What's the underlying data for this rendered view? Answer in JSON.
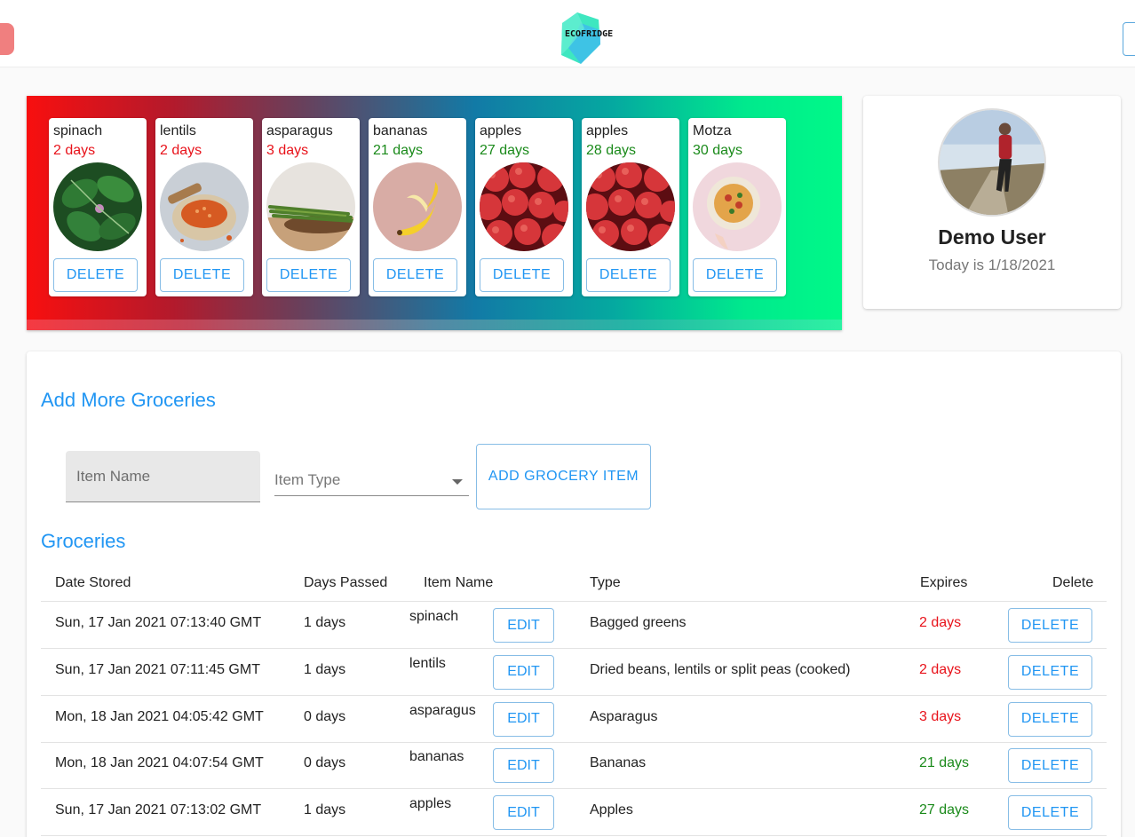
{
  "header": {
    "logo_text": "ECOFRIDGE"
  },
  "colors": {
    "accent": "#2196f3",
    "expiring_soon": "#e8121a",
    "fresh": "#1a8a1a"
  },
  "banner": {
    "cards": [
      {
        "name": "spinach",
        "days": "2 days",
        "status": "expiring",
        "image": "spinach-photo",
        "delete_label": "DELETE"
      },
      {
        "name": "lentils",
        "days": "2 days",
        "status": "expiring",
        "image": "lentils-photo",
        "delete_label": "DELETE"
      },
      {
        "name": "asparagus",
        "days": "3 days",
        "status": "expiring",
        "image": "asparagus-photo",
        "delete_label": "DELETE"
      },
      {
        "name": "bananas",
        "days": "21 days",
        "status": "fresh",
        "image": "banana-photo",
        "delete_label": "DELETE"
      },
      {
        "name": "apples",
        "days": "27 days",
        "status": "fresh",
        "image": "apples-photo",
        "delete_label": "DELETE"
      },
      {
        "name": "apples",
        "days": "28 days",
        "status": "fresh",
        "image": "apples-photo",
        "delete_label": "DELETE"
      },
      {
        "name": "Motza",
        "days": "30 days",
        "status": "fresh",
        "image": "pizza-photo",
        "delete_label": "DELETE"
      }
    ]
  },
  "profile": {
    "name": "Demo User",
    "date_text": "Today is 1/18/2021"
  },
  "form": {
    "title": "Add More Groceries",
    "item_name_placeholder": "Item Name",
    "item_type_placeholder": "Item Type",
    "add_button_label": "ADD GROCERY ITEM"
  },
  "groceries": {
    "title": "Groceries",
    "columns": [
      "Date Stored",
      "Days Passed",
      "Item Name",
      "Type",
      "Expires",
      "Delete"
    ],
    "rows": [
      {
        "date": "Sun, 17 Jan 2021 07:13:40 GMT",
        "days_passed": "1 days",
        "name": "spinach",
        "edit": "EDIT",
        "type": "Bagged greens",
        "expires": "2 days",
        "status": "expiring",
        "delete": "DELETE"
      },
      {
        "date": "Sun, 17 Jan 2021 07:11:45 GMT",
        "days_passed": "1 days",
        "name": "lentils",
        "edit": "EDIT",
        "type": "Dried beans, lentils or split peas (cooked)",
        "expires": "2 days",
        "status": "expiring",
        "delete": "DELETE"
      },
      {
        "date": "Mon, 18 Jan 2021 04:05:42 GMT",
        "days_passed": "0 days",
        "name": "asparagus",
        "edit": "EDIT",
        "type": "Asparagus",
        "expires": "3 days",
        "status": "expiring",
        "delete": "DELETE"
      },
      {
        "date": "Mon, 18 Jan 2021 04:07:54 GMT",
        "days_passed": "0 days",
        "name": "bananas",
        "edit": "EDIT",
        "type": "Bananas",
        "expires": "21 days",
        "status": "fresh",
        "delete": "DELETE"
      },
      {
        "date": "Sun, 17 Jan 2021 07:13:02 GMT",
        "days_passed": "1 days",
        "name": "apples",
        "edit": "EDIT",
        "type": "Apples",
        "expires": "27 days",
        "status": "fresh",
        "delete": "DELETE"
      }
    ]
  }
}
